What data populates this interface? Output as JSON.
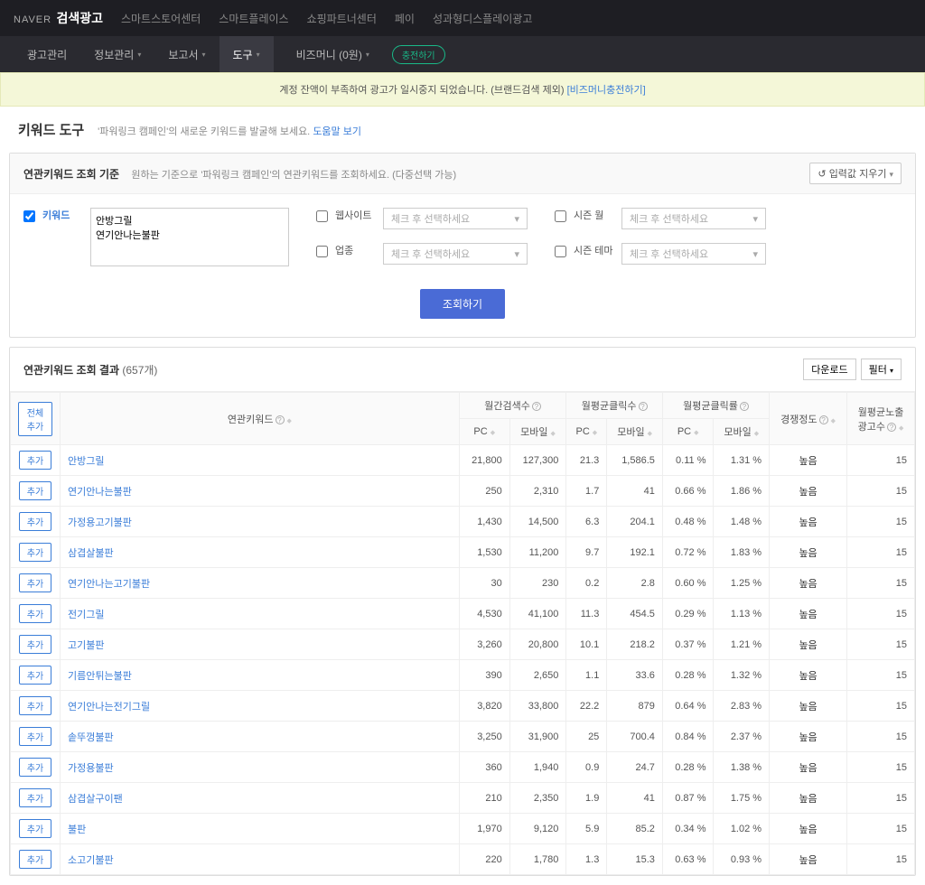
{
  "top_nav": {
    "brand_prefix": "NAVER",
    "brand": "검색광고",
    "links": [
      "스마트스토어센터",
      "스마트플레이스",
      "쇼핑파트너센터",
      "페이",
      "성과형디스플레이광고"
    ]
  },
  "sub_nav": {
    "items": [
      "광고관리",
      "정보관리",
      "보고서",
      "도구",
      "비즈머니 (0원)"
    ],
    "charge_btn": "충전하기"
  },
  "alert": {
    "text": "계정 잔액이 부족하여 광고가 일시중지 되었습니다. (브랜드검색 제외)",
    "link": "[비즈머니충전하기]"
  },
  "page_head": {
    "title": "키워드 도구",
    "sub_pre": "'파워링크 캠페인'",
    "sub_post": "의 새로운 키워드를 발굴해 보세요.",
    "help": "도움말 보기"
  },
  "filter": {
    "panel_title": "연관키워드 조회 기준",
    "panel_desc": "원하는 기준으로 '파워링크 캠페인'의 연관키워드를 조회하세요. (다중선택 가능)",
    "clear_btn": "입력값 지우기",
    "keyword_label": "키워드",
    "keyword_value": "안방그릴\n연기안나는불판",
    "website_label": "웹사이트",
    "industry_label": "업종",
    "season_month_label": "시즌 월",
    "season_theme_label": "시즌 테마",
    "select_placeholder": "체크 후 선택하세요",
    "query_btn": "조회하기"
  },
  "result": {
    "title": "연관키워드 조회 결과",
    "count": "(657개)",
    "download_btn": "다운로드",
    "filter_btn": "필터",
    "add_all_btn": "전체추가",
    "add_btn": "추가",
    "headers": {
      "keyword": "연관키워드",
      "monthly_search": "월간검색수",
      "monthly_click": "월평균클릭수",
      "monthly_ctr": "월평균클릭률",
      "competition": "경쟁정도",
      "monthly_ads": "월평균노출\n광고수",
      "pc": "PC",
      "mobile": "모바일"
    },
    "rows": [
      {
        "kw": "안방그릴",
        "s_pc": "21,800",
        "s_mo": "127,300",
        "c_pc": "21.3",
        "c_mo": "1,586.5",
        "r_pc": "0.11 %",
        "r_mo": "1.31 %",
        "comp": "높음",
        "ads": "15"
      },
      {
        "kw": "연기안나는불판",
        "s_pc": "250",
        "s_mo": "2,310",
        "c_pc": "1.7",
        "c_mo": "41",
        "r_pc": "0.66 %",
        "r_mo": "1.86 %",
        "comp": "높음",
        "ads": "15"
      },
      {
        "kw": "가정용고기불판",
        "s_pc": "1,430",
        "s_mo": "14,500",
        "c_pc": "6.3",
        "c_mo": "204.1",
        "r_pc": "0.48 %",
        "r_mo": "1.48 %",
        "comp": "높음",
        "ads": "15"
      },
      {
        "kw": "삼겹살불판",
        "s_pc": "1,530",
        "s_mo": "11,200",
        "c_pc": "9.7",
        "c_mo": "192.1",
        "r_pc": "0.72 %",
        "r_mo": "1.83 %",
        "comp": "높음",
        "ads": "15"
      },
      {
        "kw": "연기안나는고기불판",
        "s_pc": "30",
        "s_mo": "230",
        "c_pc": "0.2",
        "c_mo": "2.8",
        "r_pc": "0.60 %",
        "r_mo": "1.25 %",
        "comp": "높음",
        "ads": "15"
      },
      {
        "kw": "전기그릴",
        "s_pc": "4,530",
        "s_mo": "41,100",
        "c_pc": "11.3",
        "c_mo": "454.5",
        "r_pc": "0.29 %",
        "r_mo": "1.13 %",
        "comp": "높음",
        "ads": "15"
      },
      {
        "kw": "고기불판",
        "s_pc": "3,260",
        "s_mo": "20,800",
        "c_pc": "10.1",
        "c_mo": "218.2",
        "r_pc": "0.37 %",
        "r_mo": "1.21 %",
        "comp": "높음",
        "ads": "15"
      },
      {
        "kw": "기름안튀는불판",
        "s_pc": "390",
        "s_mo": "2,650",
        "c_pc": "1.1",
        "c_mo": "33.6",
        "r_pc": "0.28 %",
        "r_mo": "1.32 %",
        "comp": "높음",
        "ads": "15"
      },
      {
        "kw": "연기안나는전기그릴",
        "s_pc": "3,820",
        "s_mo": "33,800",
        "c_pc": "22.2",
        "c_mo": "879",
        "r_pc": "0.64 %",
        "r_mo": "2.83 %",
        "comp": "높음",
        "ads": "15"
      },
      {
        "kw": "솥뚜껑불판",
        "s_pc": "3,250",
        "s_mo": "31,900",
        "c_pc": "25",
        "c_mo": "700.4",
        "r_pc": "0.84 %",
        "r_mo": "2.37 %",
        "comp": "높음",
        "ads": "15"
      },
      {
        "kw": "가정용불판",
        "s_pc": "360",
        "s_mo": "1,940",
        "c_pc": "0.9",
        "c_mo": "24.7",
        "r_pc": "0.28 %",
        "r_mo": "1.38 %",
        "comp": "높음",
        "ads": "15"
      },
      {
        "kw": "삼겹살구이팬",
        "s_pc": "210",
        "s_mo": "2,350",
        "c_pc": "1.9",
        "c_mo": "41",
        "r_pc": "0.87 %",
        "r_mo": "1.75 %",
        "comp": "높음",
        "ads": "15"
      },
      {
        "kw": "불판",
        "s_pc": "1,970",
        "s_mo": "9,120",
        "c_pc": "5.9",
        "c_mo": "85.2",
        "r_pc": "0.34 %",
        "r_mo": "1.02 %",
        "comp": "높음",
        "ads": "15"
      },
      {
        "kw": "소고기불판",
        "s_pc": "220",
        "s_mo": "1,780",
        "c_pc": "1.3",
        "c_mo": "15.3",
        "r_pc": "0.63 %",
        "r_mo": "0.93 %",
        "comp": "높음",
        "ads": "15"
      }
    ]
  }
}
